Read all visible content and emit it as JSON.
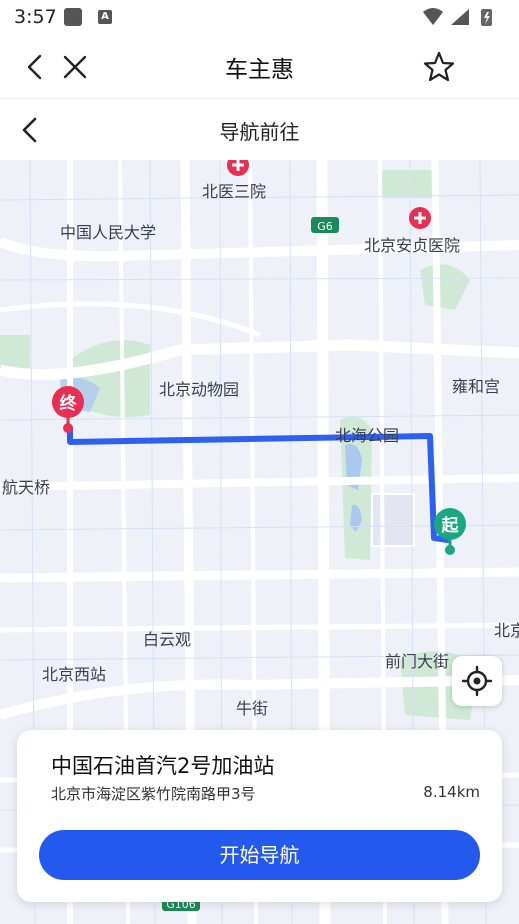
{
  "status_bar": {
    "time": "3:57"
  },
  "app_bar": {
    "title": "车主惠"
  },
  "sub_bar": {
    "title": "导航前往"
  },
  "map": {
    "labels": {
      "beiyi3": "北医三院",
      "renmin": "中国人民大学",
      "anzhen": "北京安贞医院",
      "zoo": "北京动物园",
      "yonghe": "雍和宫",
      "beihai": "北海公园",
      "hangtian": "航天桥",
      "baiyun": "白云观",
      "xizhan": "北京西站",
      "qianmen": "前门大街",
      "niujie": "牛街",
      "beijing_right": "北京",
      "g6": "G6",
      "g106": "G106"
    },
    "start_marker": "起",
    "end_marker": "终"
  },
  "destination": {
    "name": "中国石油首汽2号加油站",
    "address": "北京市海淀区紫竹院南路甲3号",
    "distance": "8.14km",
    "start_button": "开始导航"
  },
  "colors": {
    "route": "#2f5ff0",
    "start": "#1aa882",
    "end": "#ea2e52",
    "button": "#2459f0"
  }
}
